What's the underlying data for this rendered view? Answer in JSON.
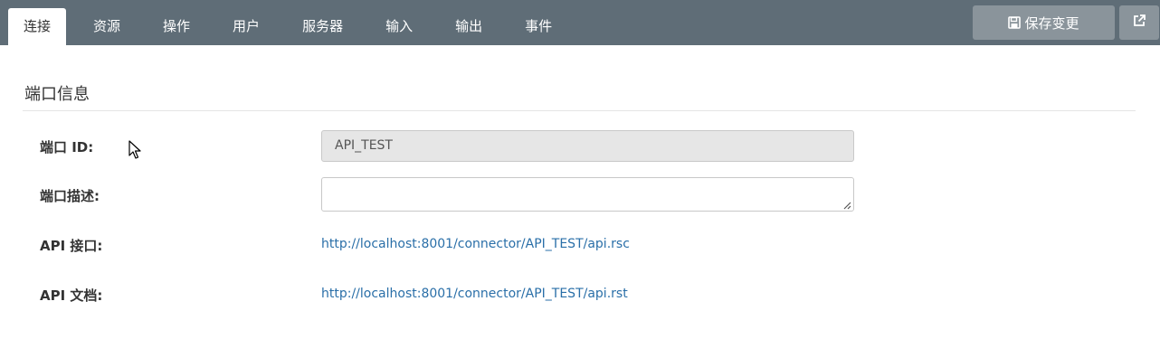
{
  "tabs": [
    {
      "label": "连接",
      "active": true
    },
    {
      "label": "资源"
    },
    {
      "label": "操作"
    },
    {
      "label": "用户"
    },
    {
      "label": "服务器"
    },
    {
      "label": "输入"
    },
    {
      "label": "输出"
    },
    {
      "label": "事件"
    }
  ],
  "toolbar": {
    "save_label": "保存变更",
    "save_icon": "save-icon",
    "external_icon": "external-link-icon"
  },
  "section": {
    "title": "端口信息"
  },
  "form": {
    "port_id_label": "端口 ID:",
    "port_id_value": "API_TEST",
    "port_desc_label": "端口描述:",
    "port_desc_value": "",
    "api_endpoint_label": "API 接口:",
    "api_endpoint_url": "http://localhost:8001/connector/API_TEST/api.rsc",
    "api_doc_label": "API 文档:",
    "api_doc_url": "http://localhost:8001/connector/API_TEST/api.rst"
  },
  "colors": {
    "topbar": "#5f6d77",
    "button": "#8a949b",
    "link": "#2a6fa8"
  }
}
